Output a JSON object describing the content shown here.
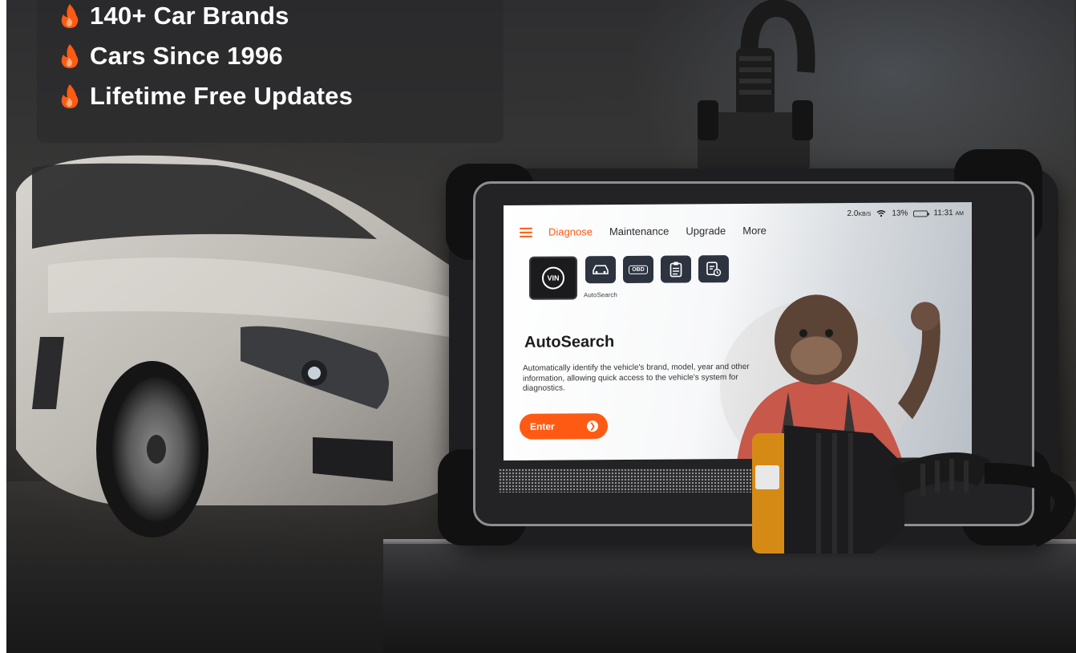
{
  "features": [
    {
      "text": "140+ Car Brands",
      "icon": "flame-icon"
    },
    {
      "text": "Cars Since 1996",
      "icon": "flame-icon"
    },
    {
      "text": "Lifetime Free Updates",
      "icon": "flame-icon"
    }
  ],
  "screen": {
    "status": {
      "speed": "2.0",
      "speed_unit": "KB/S",
      "battery": "13%",
      "time": "11:31",
      "ampm": "AM"
    },
    "nav": {
      "tabs": [
        "Diagnose",
        "Maintenance",
        "Upgrade",
        "More"
      ],
      "active": "Diagnose"
    },
    "icons": {
      "vin_label": "VIN",
      "obd_label": "OBD",
      "autosearch_label": "AutoSearch"
    },
    "title": "AutoSearch",
    "description": "Automatically identify the vehicle's brand, model, year and other information, allowing quick access to the vehicle's system for diagnostics.",
    "enter_label": "Enter"
  },
  "colors": {
    "accent": "#ff5a14",
    "icon_bg": "#2d3440",
    "flame": "#ff5a14"
  }
}
